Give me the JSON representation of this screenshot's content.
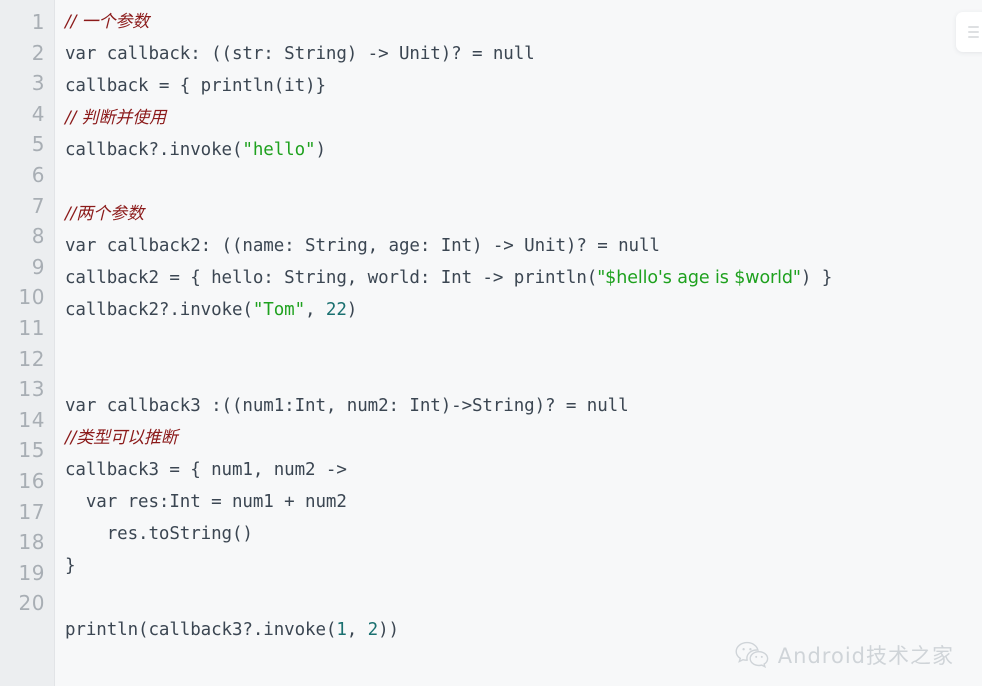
{
  "editor": {
    "language": "kotlin",
    "total_lines": 20,
    "background_color": "#f7f8f9",
    "gutter_color": "#eceef0",
    "line_numbers": [
      "1",
      "2",
      "3",
      "4",
      "5",
      "6",
      "7",
      "8",
      "9",
      "10",
      "11",
      "12",
      "13",
      "14",
      "15",
      "16",
      "17",
      "18",
      "19",
      "20"
    ],
    "colors": {
      "text": "#3b4652",
      "comment": "#8b1a1a",
      "string": "#1ea11e",
      "number": "#1a7070",
      "line_number": "#a8aeb4"
    },
    "lines": [
      {
        "n": 1,
        "tokens": [
          {
            "t": "cmt",
            "v": "// 一个参数"
          }
        ]
      },
      {
        "n": 2,
        "tokens": [
          {
            "t": "plain",
            "v": "var callback: ((str: String) -> Unit)? = null"
          }
        ]
      },
      {
        "n": 3,
        "tokens": [
          {
            "t": "plain",
            "v": "callback = { println(it)}"
          }
        ]
      },
      {
        "n": 4,
        "tokens": [
          {
            "t": "cmt",
            "v": "// 判断并使用"
          }
        ]
      },
      {
        "n": 5,
        "tokens": [
          {
            "t": "plain",
            "v": "callback?.invoke("
          },
          {
            "t": "str",
            "v": "\"hello\""
          },
          {
            "t": "plain",
            "v": ")"
          }
        ]
      },
      {
        "n": 6,
        "tokens": [
          {
            "t": "blank",
            "v": ""
          }
        ]
      },
      {
        "n": 7,
        "tokens": [
          {
            "t": "cmt",
            "v": "//两个参数"
          }
        ]
      },
      {
        "n": 8,
        "tokens": [
          {
            "t": "plain",
            "v": "var callback2: ((name: String, age: Int) -> Unit)? = null"
          }
        ]
      },
      {
        "n": 9,
        "tokens": [
          {
            "t": "plain",
            "v": "callback2 = { hello: String, world: Int -> println("
          },
          {
            "t": "strprop",
            "v": "\"$hello's age is $world\""
          },
          {
            "t": "plain",
            "v": ") }"
          }
        ]
      },
      {
        "n": 10,
        "tokens": [
          {
            "t": "plain",
            "v": "callback2?.invoke("
          },
          {
            "t": "str",
            "v": "\"Tom\""
          },
          {
            "t": "plain",
            "v": ", "
          },
          {
            "t": "num",
            "v": "22"
          },
          {
            "t": "plain",
            "v": ")"
          }
        ]
      },
      {
        "n": 11,
        "tokens": [
          {
            "t": "blank",
            "v": ""
          }
        ]
      },
      {
        "n": 12,
        "tokens": [
          {
            "t": "blank",
            "v": ""
          }
        ]
      },
      {
        "n": 13,
        "tokens": [
          {
            "t": "plain",
            "v": "var callback3 :((num1:Int, num2: Int)->String)? = null"
          }
        ]
      },
      {
        "n": 14,
        "tokens": [
          {
            "t": "cmt",
            "v": "//类型可以推断"
          }
        ]
      },
      {
        "n": 15,
        "tokens": [
          {
            "t": "plain",
            "v": "callback3 = { num1, num2 ->"
          }
        ]
      },
      {
        "n": 16,
        "tokens": [
          {
            "t": "plain",
            "v": "  var res:Int = num1 + num2"
          }
        ]
      },
      {
        "n": 17,
        "tokens": [
          {
            "t": "plain",
            "v": "    res.toString()"
          }
        ]
      },
      {
        "n": 18,
        "tokens": [
          {
            "t": "plain",
            "v": "}"
          }
        ]
      },
      {
        "n": 19,
        "tokens": [
          {
            "t": "blank",
            "v": ""
          }
        ]
      },
      {
        "n": 20,
        "tokens": [
          {
            "t": "plain",
            "v": "println(callback3?.invoke("
          },
          {
            "t": "num",
            "v": "1"
          },
          {
            "t": "plain",
            "v": ", "
          },
          {
            "t": "num",
            "v": "2"
          },
          {
            "t": "plain",
            "v": "))"
          }
        ]
      }
    ]
  },
  "copy_chip": {
    "icon": "copy-lines-icon",
    "label": ""
  },
  "watermark": {
    "icon": "wechat-logo-icon",
    "text": "Android技术之家"
  }
}
